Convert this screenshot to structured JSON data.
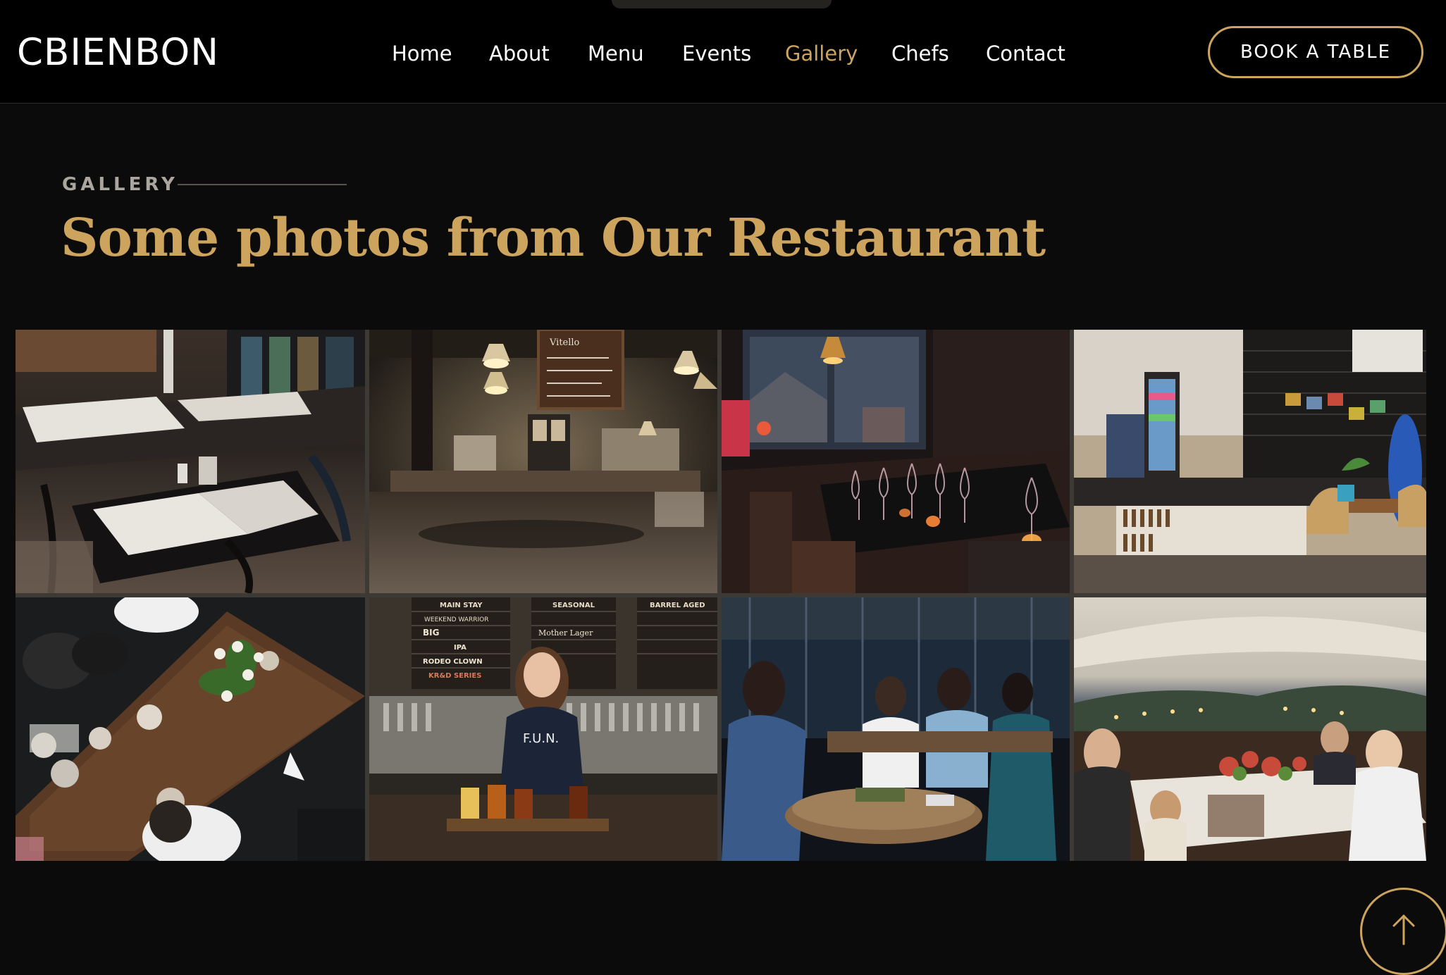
{
  "brand": "CBIENBON",
  "nav": {
    "items": [
      {
        "label": "Home",
        "active": false
      },
      {
        "label": "About",
        "active": false
      },
      {
        "label": "Menu",
        "active": false
      },
      {
        "label": "Events",
        "active": false
      },
      {
        "label": "Gallery",
        "active": true
      },
      {
        "label": "Chefs",
        "active": false
      },
      {
        "label": "Contact",
        "active": false
      }
    ],
    "cta_label": "BOOK A TABLE"
  },
  "section": {
    "label": "GALLERY",
    "title": "Some photos from Our Restaurant"
  },
  "gallery": {
    "photos": [
      {
        "subject": "Dark cafe interior with tables and menus"
      },
      {
        "subject": "Pub interior with pendant lamps and chalkboard"
      },
      {
        "subject": "Restaurant tables with wine glasses by window"
      },
      {
        "subject": "Cafe counter with drinks fridge and wooden chairs"
      },
      {
        "subject": "Overhead view of wooden table with food and flowers"
      },
      {
        "subject": "Brewery bartender with beer flight and taps"
      },
      {
        "subject": "Friends laughing on outdoor terrace"
      },
      {
        "subject": "Dinner party toasting under a tent"
      }
    ]
  },
  "signage": {
    "board_left": [
      "MAIN STAY",
      "WEEKEND WARRIOR",
      "BIG",
      "IPA",
      "RODEO CLOWN",
      "KR&D SERIES"
    ],
    "board_right": [
      "SEASONAL",
      "Mother Lager",
      "BARREL AGED"
    ],
    "shirt": "F.U.N.",
    "chalkboard": "Vitello"
  },
  "icons": {
    "scroll_top": "arrow-up-icon"
  },
  "colors": {
    "accent": "#cda45e",
    "header_bg": "#000000",
    "page_bg": "#0c0b0b",
    "nav_text": "#ffffff",
    "label_gray": "#aaa59e"
  }
}
